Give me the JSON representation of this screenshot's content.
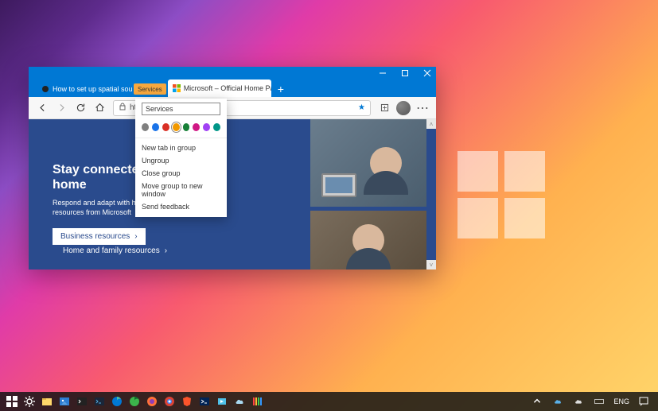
{
  "window": {
    "tabs": [
      {
        "label": "How to set up spatial sound with",
        "active": false
      },
      {
        "label": "Microsoft – Official Home Page",
        "active": true
      }
    ],
    "tab_group_label": "Services",
    "address_url": "https...us/"
  },
  "context_menu": {
    "group_name_value": "Services",
    "colors": [
      {
        "hex": "#808080",
        "selected": false
      },
      {
        "hex": "#1a73e8",
        "selected": false
      },
      {
        "hex": "#d93025",
        "selected": false
      },
      {
        "hex": "#f29900",
        "selected": true
      },
      {
        "hex": "#188038",
        "selected": false
      },
      {
        "hex": "#d01884",
        "selected": false
      },
      {
        "hex": "#a142f4",
        "selected": false
      },
      {
        "hex": "#009688",
        "selected": false
      }
    ],
    "items": [
      "New tab in group",
      "Ungroup",
      "Close group",
      "Move group to new window",
      "Send feedback"
    ]
  },
  "page": {
    "heading": "Stay connected at home",
    "paragraph": "Respond and adapt with helpful resources from Microsoft",
    "business_button": "Business resources",
    "home_link": "Home and family resources"
  },
  "system_tray": {
    "lang": "ENG"
  }
}
